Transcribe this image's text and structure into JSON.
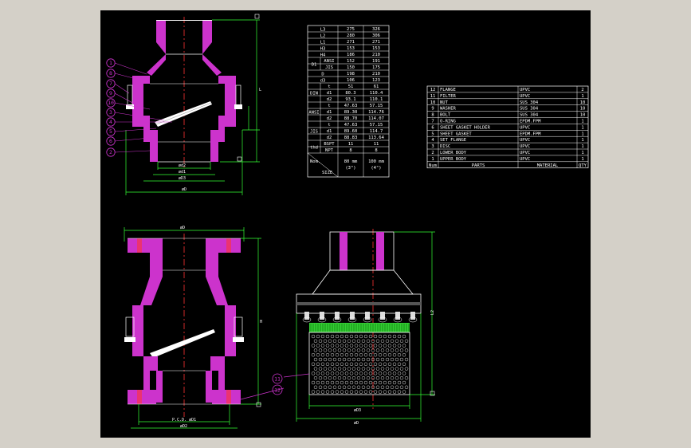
{
  "drawing": {
    "colors": {
      "background": "#d4d0c8",
      "paper": "#000000",
      "body": "#cc33cc",
      "dimension": "#33ff33",
      "outline": "#ffffff",
      "center": "#ff3333",
      "part": "#ffff55"
    },
    "dimensions": {
      "d1_small": "ød2",
      "d2_small": "ød1",
      "d3_small": "øD3",
      "d_overall": "øD",
      "top_d": "øD",
      "pcd": "P.C.D. øD1",
      "d2": "øD2",
      "d3": "øD3",
      "d_bottom": "øD",
      "l_top": "L",
      "h_right": "H",
      "h2_right": "L2"
    },
    "callouts": [
      "1",
      "8",
      "7",
      "9",
      "10",
      "3",
      "4",
      "5",
      "6",
      "2"
    ],
    "callouts_bottom": [
      "11",
      "12"
    ]
  },
  "dim_table": {
    "header": [
      "",
      "80 mm\n(3\")",
      "100 mm\n(4\")"
    ],
    "rows": [
      [
        "L3",
        "",
        "275",
        "326"
      ],
      [
        "L2",
        "",
        "280",
        "306"
      ],
      [
        "L1",
        "",
        "271",
        "271"
      ],
      [
        "H3",
        "",
        "153",
        "153"
      ],
      [
        "H4",
        "",
        "186",
        "210"
      ],
      [
        "D1",
        "ANSI",
        "152",
        "191"
      ],
      [
        "D1",
        "JIS",
        "150",
        "175"
      ],
      [
        "D",
        "",
        "198",
        "210"
      ],
      [
        "d3",
        "",
        "106",
        "123"
      ],
      [
        "DIN",
        "t",
        "51",
        "61"
      ],
      [
        "DIN",
        "d1",
        "80.3",
        "110.4"
      ],
      [
        "DIN",
        "d2",
        "93.1",
        "110.1"
      ],
      [
        "ANSI",
        "t",
        "47.63",
        "57.15"
      ],
      [
        "ANSI",
        "d1",
        "89.30",
        "114.76"
      ],
      [
        "ANSI",
        "d2",
        "88.70",
        "114.07"
      ],
      [
        "JIS",
        "t",
        "47.63",
        "57.15"
      ],
      [
        "JIS",
        "d1",
        "89.60",
        "114.7"
      ],
      [
        "JIS",
        "d2",
        "88.83",
        "113.64"
      ],
      [
        "thd",
        "BSPT",
        "11",
        "11"
      ],
      [
        "thd",
        "NPT",
        "8",
        "8"
      ]
    ],
    "nom": "Nom.",
    "size": "SIZE",
    "col80": "80 mm\n(3\")",
    "col100": "100 mm\n(4\")"
  },
  "parts_table": {
    "rows": [
      [
        "12",
        "FLANGE",
        "UPVC",
        "2"
      ],
      [
        "11",
        "FILTER",
        "UPVC",
        "1"
      ],
      [
        "10",
        "NUT",
        "SUS 304",
        "10"
      ],
      [
        "9",
        "WASHER",
        "SUS 304",
        "10"
      ],
      [
        "8",
        "BOLT",
        "SUS 304",
        "10"
      ],
      [
        "7",
        "O-RING",
        "EPDM.FPM",
        "1"
      ],
      [
        "6",
        "SHEET GASKET HOLDER",
        "UPVC",
        "1"
      ],
      [
        "5",
        "SHEET GASKET",
        "EPDM.FPM",
        "1"
      ],
      [
        "4",
        "SET FLANGE",
        "UPVC",
        "1"
      ],
      [
        "3",
        "DISC",
        "UPVC",
        "1"
      ],
      [
        "2",
        "LOWER BODY",
        "UPVC",
        "1"
      ],
      [
        "1",
        "UPPER BODY",
        "UPVC",
        "1"
      ]
    ],
    "footer": [
      "Num",
      "PARTS",
      "MATERIAL",
      "QTY"
    ]
  }
}
